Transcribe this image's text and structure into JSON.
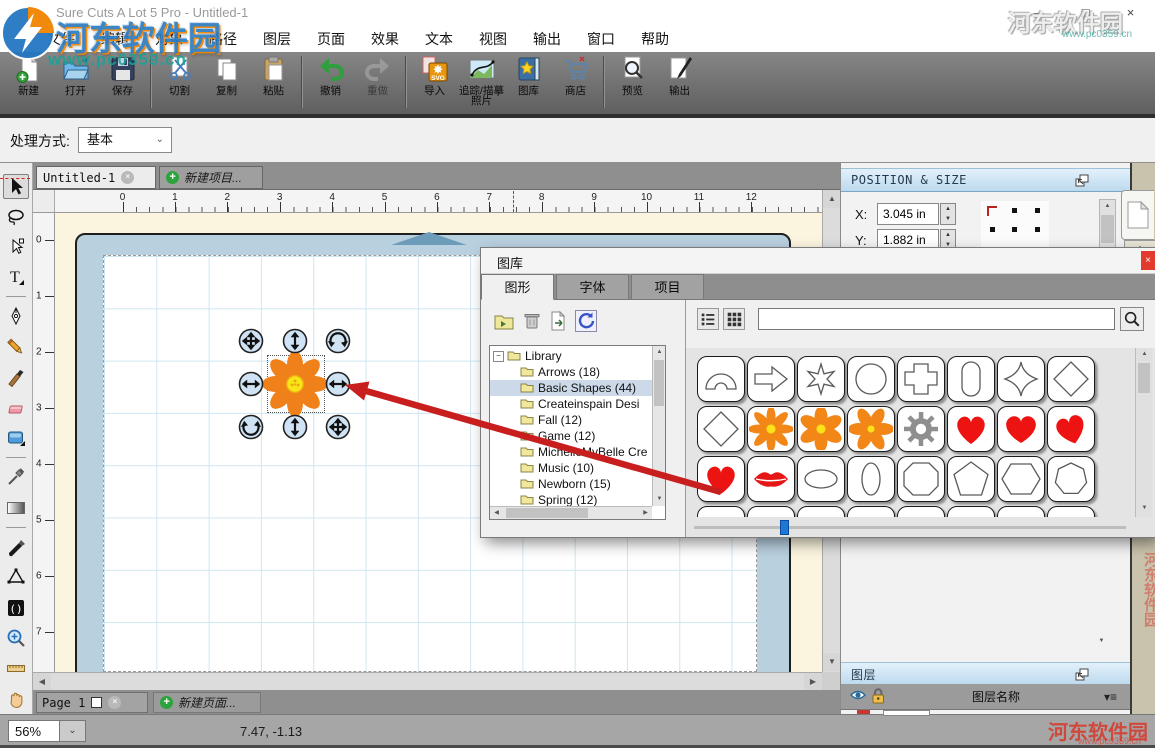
{
  "window": {
    "title": "Sure Cuts A Lot 5 Pro - Untitled-1",
    "minimize": "–",
    "maximize": "□",
    "close": "×"
  },
  "menu": {
    "items": [
      "文件",
      "编辑",
      "对象",
      "路径",
      "图层",
      "页面",
      "效果",
      "文本",
      "视图",
      "输出",
      "窗口",
      "帮助"
    ]
  },
  "toolbar": {
    "groups": [
      [
        {
          "id": "new",
          "label": "新建"
        },
        {
          "id": "open",
          "label": "打开"
        },
        {
          "id": "save",
          "label": "保存"
        }
      ],
      [
        {
          "id": "cut",
          "label": "切割"
        },
        {
          "id": "copy",
          "label": "复制"
        },
        {
          "id": "paste",
          "label": "粘贴"
        }
      ],
      [
        {
          "id": "undo",
          "label": "撤销"
        },
        {
          "id": "redo",
          "label": "重做",
          "disabled": true
        }
      ],
      [
        {
          "id": "import",
          "label": "导入"
        },
        {
          "id": "trace",
          "label": "追踪/描摹照片"
        },
        {
          "id": "library",
          "label": "图库"
        },
        {
          "id": "store",
          "label": "商店"
        }
      ],
      [
        {
          "id": "preview",
          "label": "预览"
        },
        {
          "id": "output",
          "label": "输出"
        }
      ]
    ]
  },
  "mode_bar": {
    "label": "处理方式:",
    "value": "基本"
  },
  "doc_tabs": {
    "active": "Untitled-1",
    "new_project": "新建项目..."
  },
  "rulers": {
    "horizontal": [
      "0",
      "1",
      "2",
      "3",
      "4",
      "5",
      "6",
      "7",
      "8",
      "9",
      "10",
      "11",
      "12"
    ],
    "vertical": [
      "0",
      "1",
      "2",
      "3",
      "4",
      "5",
      "6",
      "7"
    ]
  },
  "tool_palette": {
    "tools": [
      "select",
      "lasso",
      "direct-select",
      "text",
      "pen",
      "pencil",
      "brush",
      "eraser",
      "rectangle",
      "eyedropper",
      "gradient",
      "knife",
      "shape-edit",
      "bracket",
      "zoom",
      "measure",
      "hand"
    ],
    "dividers_after": [
      3,
      8,
      10
    ]
  },
  "position_panel": {
    "title": "POSITION & SIZE",
    "x_label": "X:",
    "x_value": "3.045 in",
    "y_label": "Y:",
    "y_value": "1.882 in"
  },
  "layers_panel": {
    "title": "图层",
    "name_header": "图层名称"
  },
  "library_dialog": {
    "title": "图库",
    "tabs": [
      "图形",
      "字体",
      "项目"
    ],
    "active_tab": "图形",
    "search_placeholder": "",
    "tree": {
      "root": "Library",
      "items": [
        "Arrows (18)",
        "Basic Shapes (44)",
        "Createinspain Desi",
        "Fall (12)",
        "Game (12)",
        "MichelleMyBelle Cre",
        "Music (10)",
        "Newborn (15)",
        "Spring (12)"
      ],
      "selected": "Basic Shapes (44)"
    },
    "shapes": [
      "arch",
      "arrow",
      "asterisk",
      "circle",
      "cross",
      "pill",
      "star4",
      "diamond",
      "diamond",
      "flower-a",
      "flower-b",
      "flower-c",
      "gear",
      "heart",
      "heart-round",
      "heart-tilt",
      "heart",
      "lips",
      "ellipse-h",
      "ellipse-v",
      "octagon",
      "pentagon",
      "hexagon",
      "heptagon"
    ]
  },
  "page_tabs": {
    "page": "Page 1",
    "new_page": "新建页面..."
  },
  "status_bar": {
    "zoom": "56%",
    "coords": "7.47, -1.13"
  },
  "watermark": {
    "site": "河东软件园",
    "url": "www.pc0359.cn"
  }
}
